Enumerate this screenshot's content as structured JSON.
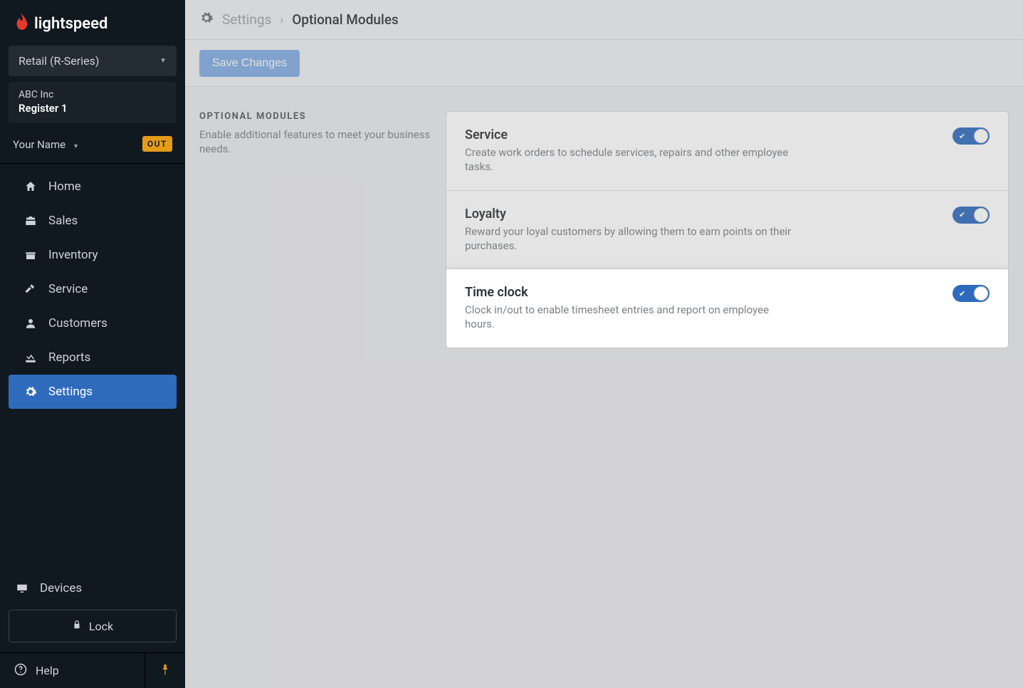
{
  "brand": "lightspeed",
  "product_select": "Retail (R-Series)",
  "account": {
    "company": "ABC Inc",
    "register": "Register 1"
  },
  "user": {
    "name": "Your Name",
    "status": "OUT"
  },
  "nav": [
    {
      "label": "Home"
    },
    {
      "label": "Sales"
    },
    {
      "label": "Inventory"
    },
    {
      "label": "Service"
    },
    {
      "label": "Customers"
    },
    {
      "label": "Reports"
    },
    {
      "label": "Settings"
    }
  ],
  "devices_label": "Devices",
  "lock_label": "Lock",
  "help_label": "Help",
  "breadcrumb": {
    "root": "Settings",
    "current": "Optional Modules"
  },
  "save_label": "Save Changes",
  "section": {
    "title": "OPTIONAL MODULES",
    "description": "Enable additional features to meet your business needs."
  },
  "modules": [
    {
      "name": "Service",
      "desc": "Create work orders to schedule services, repairs and other employee tasks.",
      "on": true,
      "highlight": false
    },
    {
      "name": "Loyalty",
      "desc": "Reward your loyal customers by allowing them to earn points on their purchases.",
      "on": true,
      "highlight": false
    },
    {
      "name": "Time clock",
      "desc": "Clock in/out to enable timesheet entries and report on employee hours.",
      "on": true,
      "highlight": true
    }
  ]
}
